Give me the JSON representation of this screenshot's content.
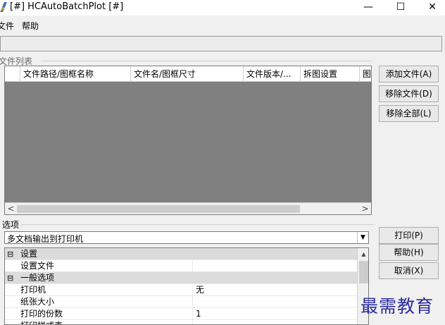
{
  "window": {
    "title": "[#] HCAutoBatchPlot [#]",
    "minimize": "—",
    "maximize": "☐",
    "close": "✕"
  },
  "menu": [
    "文件",
    "帮助"
  ],
  "file_list": {
    "group_label": "文件列表",
    "columns": [
      "文件路径/图框名称",
      "文件名/图框尺寸",
      "文件版本/...",
      "拆图设置",
      "图"
    ],
    "scroll_left": "<",
    "scroll_right": ">"
  },
  "side_buttons": [
    "添加文件(A)",
    "移除文件(D)",
    "移除全部(L)"
  ],
  "options": {
    "group_label": "选项",
    "mode_value": "多文档输出到打印机",
    "dropdown_arrow": "▼",
    "properties": [
      {
        "expander": "⊟",
        "name": "设置",
        "value": "",
        "category": true
      },
      {
        "expander": "",
        "name": "设置文件",
        "value": "",
        "category": false
      },
      {
        "expander": "⊟",
        "name": "一般选项",
        "value": "",
        "category": true
      },
      {
        "expander": "",
        "name": "打印机",
        "value": "无",
        "category": false
      },
      {
        "expander": "",
        "name": "纸张大小",
        "value": "",
        "category": false
      },
      {
        "expander": "",
        "name": "打印的份数",
        "value": "1",
        "category": false
      },
      {
        "expander": "",
        "name": "打印样式表",
        "value": "",
        "category": false
      }
    ],
    "scroll_up": "▲"
  },
  "action_buttons": [
    "打印(P)",
    "帮助(H)",
    "取消(X)"
  ],
  "watermark": "最需教育"
}
